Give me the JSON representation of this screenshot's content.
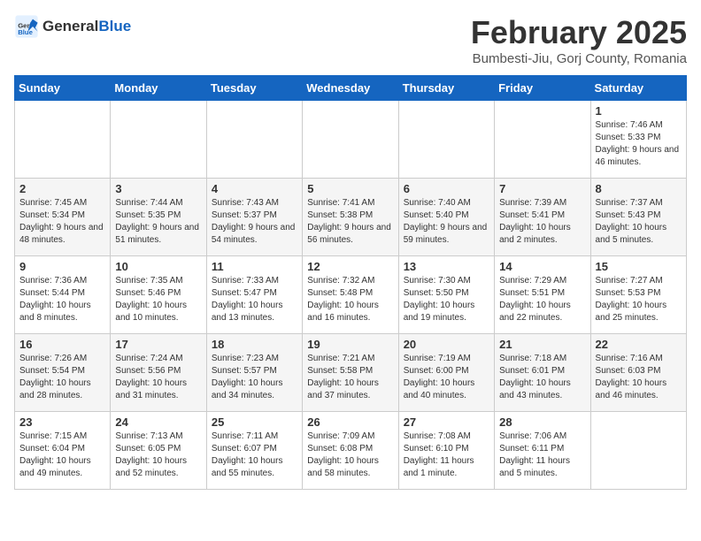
{
  "header": {
    "logo_general": "General",
    "logo_blue": "Blue",
    "title": "February 2025",
    "subtitle": "Bumbesti-Jiu, Gorj County, Romania"
  },
  "weekdays": [
    "Sunday",
    "Monday",
    "Tuesday",
    "Wednesday",
    "Thursday",
    "Friday",
    "Saturday"
  ],
  "weeks": [
    [
      null,
      null,
      null,
      null,
      null,
      null,
      {
        "day": "1",
        "info": "Sunrise: 7:46 AM\nSunset: 5:33 PM\nDaylight: 9 hours and 46 minutes."
      }
    ],
    [
      {
        "day": "2",
        "info": "Sunrise: 7:45 AM\nSunset: 5:34 PM\nDaylight: 9 hours and 48 minutes."
      },
      {
        "day": "3",
        "info": "Sunrise: 7:44 AM\nSunset: 5:35 PM\nDaylight: 9 hours and 51 minutes."
      },
      {
        "day": "4",
        "info": "Sunrise: 7:43 AM\nSunset: 5:37 PM\nDaylight: 9 hours and 54 minutes."
      },
      {
        "day": "5",
        "info": "Sunrise: 7:41 AM\nSunset: 5:38 PM\nDaylight: 9 hours and 56 minutes."
      },
      {
        "day": "6",
        "info": "Sunrise: 7:40 AM\nSunset: 5:40 PM\nDaylight: 9 hours and 59 minutes."
      },
      {
        "day": "7",
        "info": "Sunrise: 7:39 AM\nSunset: 5:41 PM\nDaylight: 10 hours and 2 minutes."
      },
      {
        "day": "8",
        "info": "Sunrise: 7:37 AM\nSunset: 5:43 PM\nDaylight: 10 hours and 5 minutes."
      }
    ],
    [
      {
        "day": "9",
        "info": "Sunrise: 7:36 AM\nSunset: 5:44 PM\nDaylight: 10 hours and 8 minutes."
      },
      {
        "day": "10",
        "info": "Sunrise: 7:35 AM\nSunset: 5:46 PM\nDaylight: 10 hours and 10 minutes."
      },
      {
        "day": "11",
        "info": "Sunrise: 7:33 AM\nSunset: 5:47 PM\nDaylight: 10 hours and 13 minutes."
      },
      {
        "day": "12",
        "info": "Sunrise: 7:32 AM\nSunset: 5:48 PM\nDaylight: 10 hours and 16 minutes."
      },
      {
        "day": "13",
        "info": "Sunrise: 7:30 AM\nSunset: 5:50 PM\nDaylight: 10 hours and 19 minutes."
      },
      {
        "day": "14",
        "info": "Sunrise: 7:29 AM\nSunset: 5:51 PM\nDaylight: 10 hours and 22 minutes."
      },
      {
        "day": "15",
        "info": "Sunrise: 7:27 AM\nSunset: 5:53 PM\nDaylight: 10 hours and 25 minutes."
      }
    ],
    [
      {
        "day": "16",
        "info": "Sunrise: 7:26 AM\nSunset: 5:54 PM\nDaylight: 10 hours and 28 minutes."
      },
      {
        "day": "17",
        "info": "Sunrise: 7:24 AM\nSunset: 5:56 PM\nDaylight: 10 hours and 31 minutes."
      },
      {
        "day": "18",
        "info": "Sunrise: 7:23 AM\nSunset: 5:57 PM\nDaylight: 10 hours and 34 minutes."
      },
      {
        "day": "19",
        "info": "Sunrise: 7:21 AM\nSunset: 5:58 PM\nDaylight: 10 hours and 37 minutes."
      },
      {
        "day": "20",
        "info": "Sunrise: 7:19 AM\nSunset: 6:00 PM\nDaylight: 10 hours and 40 minutes."
      },
      {
        "day": "21",
        "info": "Sunrise: 7:18 AM\nSunset: 6:01 PM\nDaylight: 10 hours and 43 minutes."
      },
      {
        "day": "22",
        "info": "Sunrise: 7:16 AM\nSunset: 6:03 PM\nDaylight: 10 hours and 46 minutes."
      }
    ],
    [
      {
        "day": "23",
        "info": "Sunrise: 7:15 AM\nSunset: 6:04 PM\nDaylight: 10 hours and 49 minutes."
      },
      {
        "day": "24",
        "info": "Sunrise: 7:13 AM\nSunset: 6:05 PM\nDaylight: 10 hours and 52 minutes."
      },
      {
        "day": "25",
        "info": "Sunrise: 7:11 AM\nSunset: 6:07 PM\nDaylight: 10 hours and 55 minutes."
      },
      {
        "day": "26",
        "info": "Sunrise: 7:09 AM\nSunset: 6:08 PM\nDaylight: 10 hours and 58 minutes."
      },
      {
        "day": "27",
        "info": "Sunrise: 7:08 AM\nSunset: 6:10 PM\nDaylight: 11 hours and 1 minute."
      },
      {
        "day": "28",
        "info": "Sunrise: 7:06 AM\nSunset: 6:11 PM\nDaylight: 11 hours and 5 minutes."
      },
      null
    ]
  ]
}
